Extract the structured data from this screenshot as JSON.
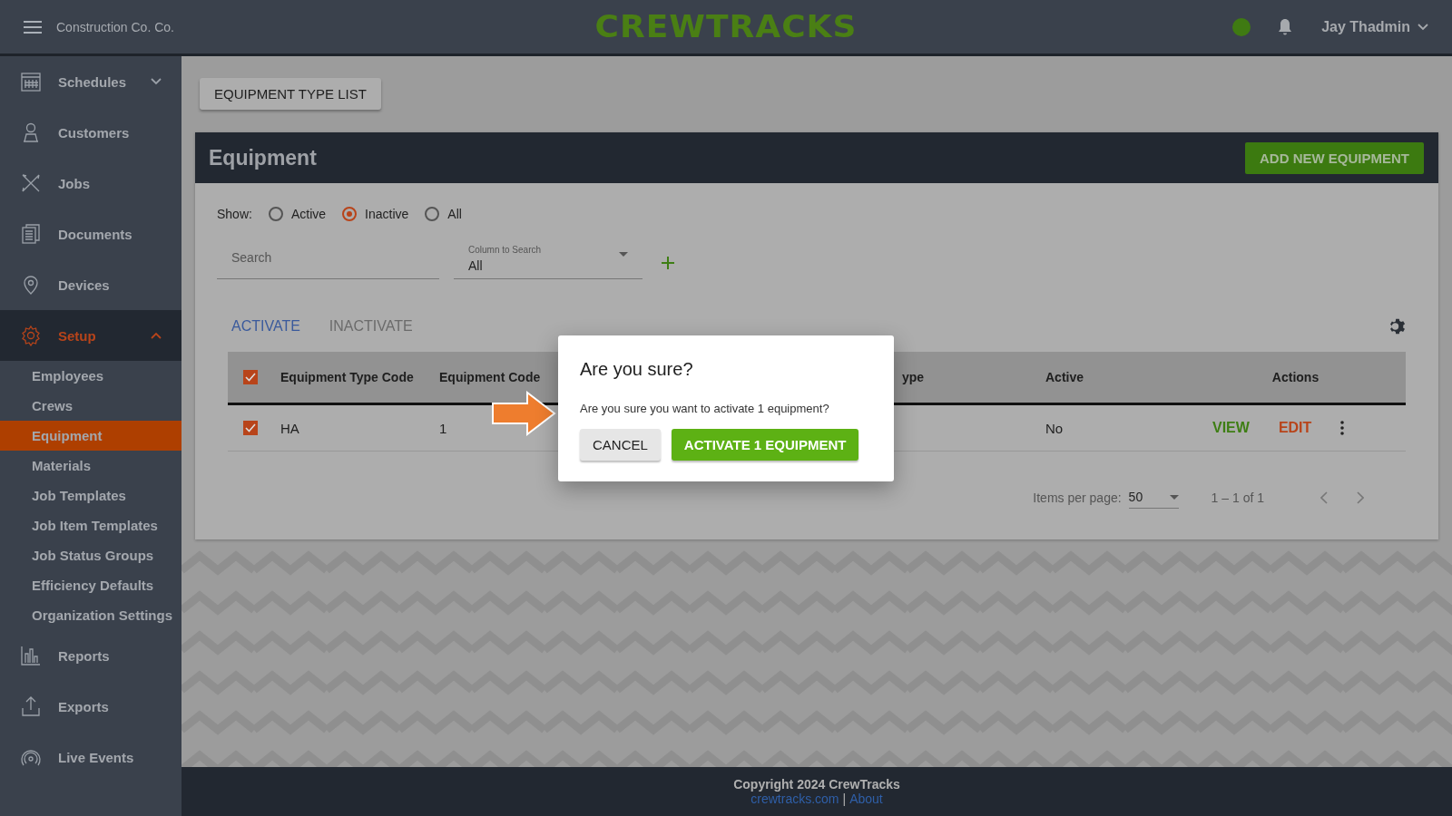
{
  "header": {
    "org_name": "Construction Co. Co.",
    "logo": "CREWTRACKS",
    "connected": true,
    "user_name": "Jay Thadmin"
  },
  "sidebar": {
    "items": [
      {
        "label": "Schedules",
        "kind": "group",
        "expanded": false,
        "selected": false
      },
      {
        "label": "Customers",
        "kind": "link",
        "selected": false
      },
      {
        "label": "Jobs",
        "kind": "link",
        "selected": false
      },
      {
        "label": "Documents",
        "kind": "link",
        "selected": false
      },
      {
        "label": "Devices",
        "kind": "link",
        "selected": false
      },
      {
        "label": "Setup",
        "kind": "group",
        "expanded": true,
        "selected": true,
        "children": [
          {
            "label": "Employees",
            "selected": false
          },
          {
            "label": "Crews",
            "selected": false
          },
          {
            "label": "Equipment",
            "selected": true
          },
          {
            "label": "Materials",
            "selected": false
          },
          {
            "label": "Job Templates",
            "selected": false
          },
          {
            "label": "Job Item Templates",
            "selected": false
          },
          {
            "label": "Job Status Groups",
            "selected": false
          },
          {
            "label": "Efficiency Defaults",
            "selected": false
          },
          {
            "label": "Organization Settings",
            "selected": false
          }
        ]
      },
      {
        "label": "Reports",
        "kind": "link",
        "selected": false
      },
      {
        "label": "Exports",
        "kind": "link",
        "selected": false
      },
      {
        "label": "Live Events",
        "kind": "link",
        "selected": false
      }
    ]
  },
  "page": {
    "type_list_button": "EQUIPMENT TYPE LIST",
    "title": "Equipment",
    "add_button": "ADD NEW EQUIPMENT",
    "show_label": "Show:",
    "show_options": [
      {
        "label": "Active",
        "selected": false
      },
      {
        "label": "Inactive",
        "selected": true
      },
      {
        "label": "All",
        "selected": false
      }
    ],
    "search": {
      "placeholder": "Search"
    },
    "column_select": {
      "label": "Column to Search",
      "value": "All"
    },
    "bulk_actions": [
      {
        "label": "ACTIVATE",
        "disabled": false
      },
      {
        "label": "INACTIVATE",
        "disabled": true
      }
    ],
    "table": {
      "select_all_checked": true,
      "columns": [
        {
          "label": "Equipment Type Code"
        },
        {
          "label": "Equipment Code"
        },
        {
          "label": "ype"
        },
        {
          "label": "Active"
        },
        {
          "label": "Actions"
        }
      ],
      "rows": [
        {
          "checked": true,
          "equipment_type_code": "HA",
          "equipment_code": "1",
          "active": "No",
          "actions": [
            {
              "label": "VIEW",
              "kind": "view"
            },
            {
              "label": "EDIT",
              "kind": "edit"
            }
          ]
        }
      ]
    },
    "pagination": {
      "label": "Items per page:",
      "page_size": "50",
      "range": "1 – 1 of 1"
    }
  },
  "dialog": {
    "title": "Are you sure?",
    "message": "Are you sure you want to activate 1 equipment?",
    "buttons": [
      {
        "label": "CANCEL",
        "kind": "secondary"
      },
      {
        "label": "ACTIVATE 1 EQUIPMENT",
        "kind": "primary"
      }
    ]
  },
  "footer": {
    "copyright": "Copyright 2024 CrewTracks",
    "links": [
      "crewtracks.com",
      "About"
    ],
    "separator": "|"
  }
}
